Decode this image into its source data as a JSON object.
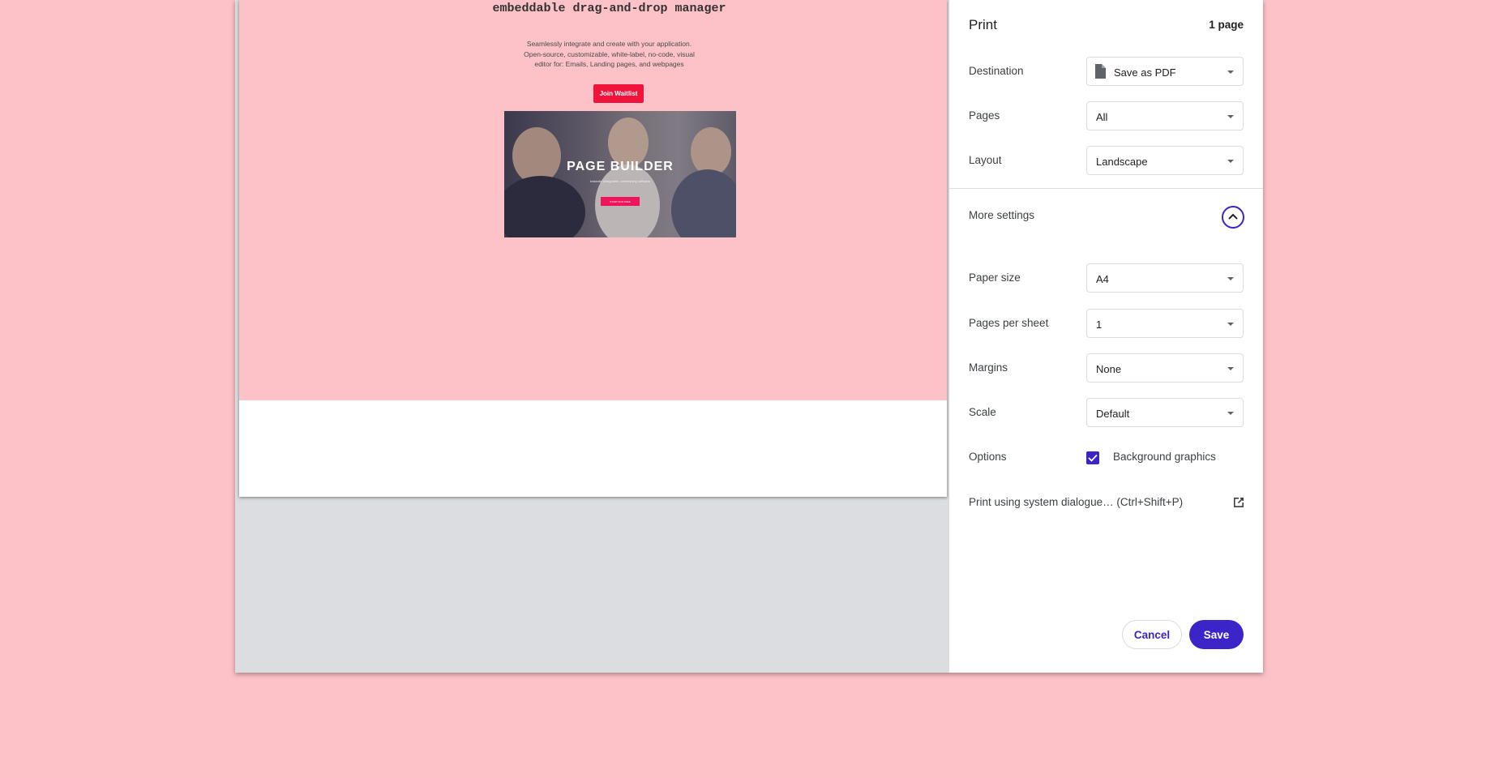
{
  "preview": {
    "headline": "embeddable drag-and-drop manager",
    "tagline": [
      "Seamlessly integrate and create with your application.",
      "Open-source, customizable, white-label, no-code, visual",
      "editor for: Emails, Landing pages, and webpages"
    ],
    "join_button": "Join Waitlist",
    "hero": {
      "title": "PAGE BUILDER",
      "subtitle": "Instantly designable, astonishing software",
      "button": "START FOR FREE"
    }
  },
  "settings": {
    "title": "Print",
    "page_count": "1 page",
    "destination": {
      "label": "Destination",
      "value": "Save as PDF"
    },
    "pages": {
      "label": "Pages",
      "value": "All"
    },
    "layout": {
      "label": "Layout",
      "value": "Landscape"
    },
    "more_settings": "More settings",
    "paper_size": {
      "label": "Paper size",
      "value": "A4"
    },
    "pages_per_sheet": {
      "label": "Pages per sheet",
      "value": "1"
    },
    "margins": {
      "label": "Margins",
      "value": "None"
    },
    "scale": {
      "label": "Scale",
      "value": "Default"
    },
    "options": {
      "label": "Options",
      "checkbox_label": "Background graphics",
      "checked": true
    },
    "system_dialog": "Print using system dialogue… (Ctrl+Shift+P)",
    "cancel": "Cancel",
    "save": "Save"
  },
  "colors": {
    "accent": "#3b25c9",
    "page_bg": "#fdc2c7",
    "cta_red": "#f0133b"
  },
  "icons": [
    "document-icon",
    "chevron-down-icon",
    "chevron-up-icon",
    "checkmark-icon",
    "external-link-icon"
  ]
}
